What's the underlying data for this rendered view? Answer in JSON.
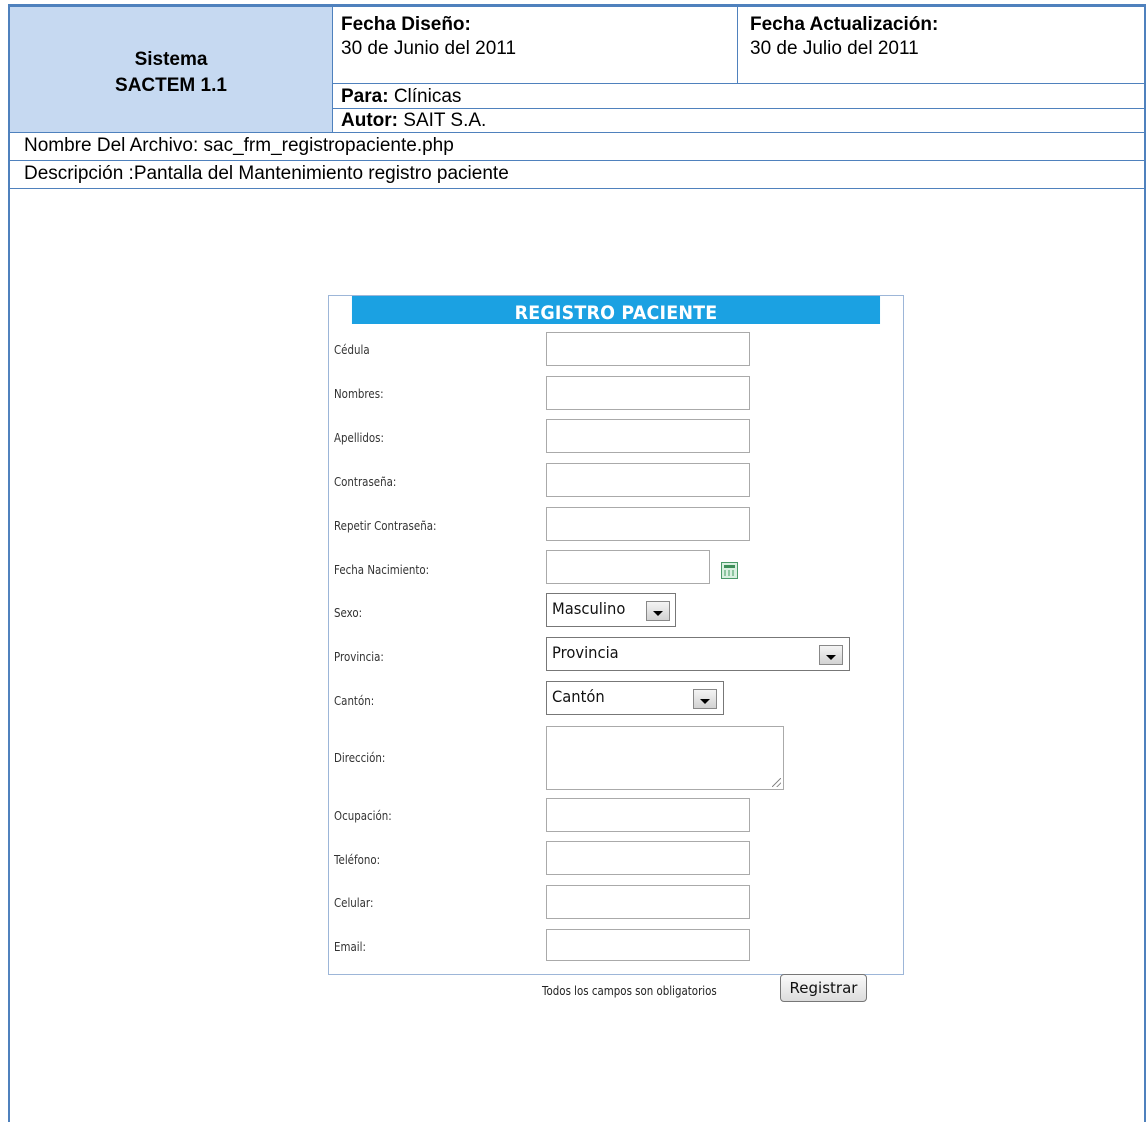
{
  "header": {
    "system_label": "Sistema",
    "system_name": "SACTEM 1.1",
    "design_date_label": "Fecha Diseño:",
    "design_date": "30 de Junio del 2011",
    "update_date_label": "Fecha Actualización:",
    "update_date": "30 de Julio del 2011",
    "for_label": "Para:",
    "for_value": "Clínicas",
    "author_label": "Autor:",
    "author_value": "SAIT S.A.",
    "file_name": "Nombre Del Archivo: sac_frm_registropaciente.php",
    "description": "Descripción :Pantalla del Mantenimiento registro paciente"
  },
  "form": {
    "title": "REGISTRO PACIENTE",
    "labels": {
      "cedula": "Cédula",
      "nombres": "Nombres:",
      "apellidos": "Apellidos:",
      "contrasena": "Contraseña:",
      "repetir": "Repetir Contraseña:",
      "fecha": "Fecha Nacimiento:",
      "sexo": "Sexo:",
      "provincia": "Provincia:",
      "canton": "Cantón:",
      "direccion": "Dirección:",
      "ocupacion": "Ocupación:",
      "telefono": "Teléfono:",
      "celular": "Celular:",
      "email": "Email:"
    },
    "selects": {
      "sexo": "Masculino",
      "provincia": "Provincia",
      "canton": "Cantón"
    },
    "note": "Todos los campos son obligatorios",
    "submit_label": "Registrar",
    "icons": {
      "calendar": "calendar-icon",
      "dropdown": "chevron-down-icon"
    },
    "colors": {
      "title_bar": "#1ba1e2",
      "header_fill": "#c6d9f1",
      "border": "#4f81bd"
    }
  }
}
